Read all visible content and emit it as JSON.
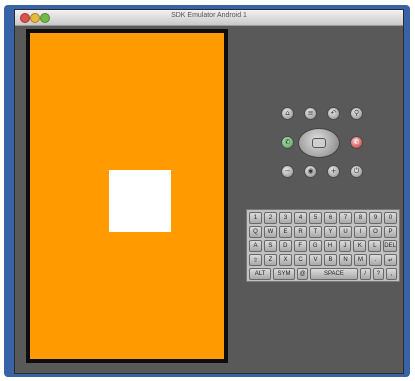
{
  "window": {
    "title": "SDK Emulator Android 1"
  },
  "screen": {
    "background_color": "#ff9a00",
    "square_color": "#ffffff"
  },
  "controls": {
    "top_row": [
      {
        "name": "home-icon",
        "glyph": "⌂"
      },
      {
        "name": "menu-icon",
        "glyph": "≡"
      },
      {
        "name": "back-icon",
        "glyph": "↶"
      },
      {
        "name": "search-icon",
        "glyph": "⚲"
      }
    ],
    "call": {
      "glyph": "✆"
    },
    "end_call": {
      "glyph": "✆"
    },
    "bottom_row": [
      {
        "name": "volume-down-icon",
        "glyph": "−"
      },
      {
        "name": "camera-icon",
        "glyph": "◉"
      },
      {
        "name": "volume-up-icon",
        "glyph": "+"
      },
      {
        "name": "power-icon",
        "glyph": "⏻"
      }
    ]
  },
  "keyboard": {
    "rows": [
      [
        "1",
        "2",
        "3",
        "4",
        "5",
        "6",
        "7",
        "8",
        "9",
        "0"
      ],
      [
        "Q",
        "W",
        "E",
        "R",
        "T",
        "Y",
        "U",
        "I",
        "O",
        "P"
      ],
      [
        "A",
        "S",
        "D",
        "F",
        "G",
        "H",
        "J",
        "K",
        "L",
        "DEL"
      ],
      [
        "⇧",
        "Z",
        "X",
        "C",
        "V",
        "B",
        "N",
        "M",
        ".",
        "↵"
      ],
      [
        "ALT",
        "SYM",
        "@",
        "SPACE",
        "/",
        "?",
        ","
      ]
    ]
  }
}
